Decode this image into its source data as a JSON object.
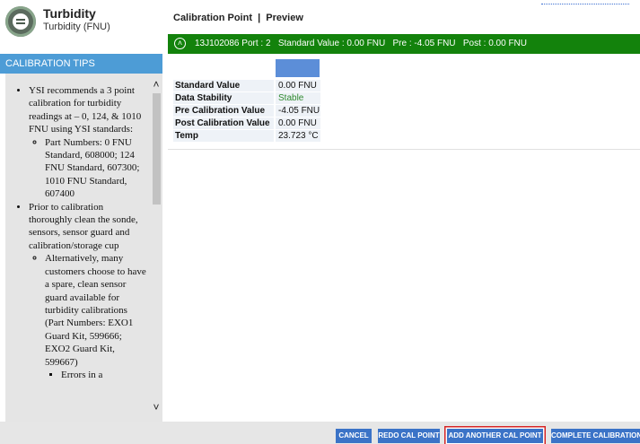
{
  "sensor": {
    "title": "Turbidity",
    "subtitle": "Turbidity (FNU)"
  },
  "tips": {
    "header": "CALIBRATION TIPS",
    "item1": "YSI recommends a 3 point calibration for turbidity readings at – 0, 124, & 1010 FNU using YSI standards:",
    "item1_sub1": "Part Numbers: 0 FNU Standard, 608000; 124 FNU Standard, 607300; 1010 FNU Standard, 607400",
    "item2": "Prior to calibration thoroughly clean the sonde, sensors, sensor guard and calibration/storage cup",
    "item2_sub1": "Alternatively, many customers choose to have a spare, clean sensor guard available for turbidity calibrations (Part Numbers: EXO1 Guard Kit, 599666; EXO2 Guard Kit, 599667)",
    "item2_sub1_sub1": "Errors in a"
  },
  "main": {
    "title": "Calibration Point  |  Preview",
    "cal_summary": "13J102086 Port : 2   Standard Value : 0.00 FNU   Pre : -4.05 FNU   Post : 0.00 FNU",
    "details": [
      {
        "label": "Standard Value",
        "value": "0.00 FNU"
      },
      {
        "label": "Data Stability",
        "value": "Stable"
      },
      {
        "label": "Pre Calibration Value",
        "value": "-4.05 FNU"
      },
      {
        "label": "Post Calibration Value",
        "value": "0.00 FNU"
      },
      {
        "label": "Temp",
        "value": "23.723 °C"
      }
    ]
  },
  "buttons": {
    "cancel": "CANCEL",
    "redo": "REDO CAL POINT",
    "add": "ADD ANOTHER CAL POINT",
    "complete": "COMPLETE CALIBRATION"
  },
  "colors": {
    "accent_green": "#13820c",
    "accent_blue": "#3b73c7",
    "tips_header": "#4d9cd6",
    "highlight_red": "#d42424",
    "stable_text": "#2f8a2f"
  }
}
